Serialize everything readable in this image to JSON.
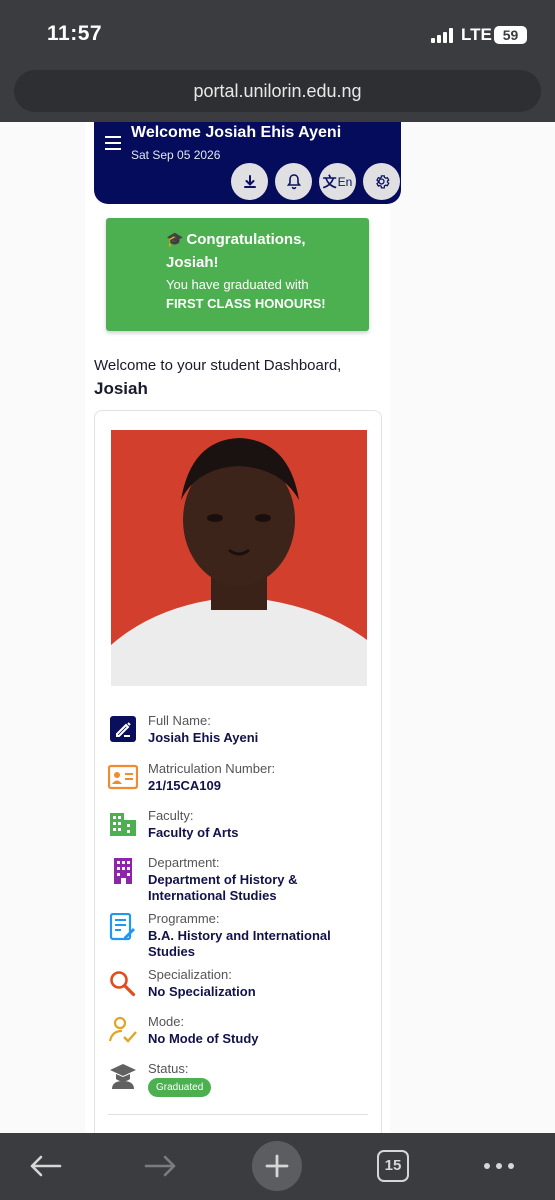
{
  "status_bar": {
    "time": "11:57",
    "network": "LTE",
    "battery": "59"
  },
  "browser": {
    "url": "portal.unilorin.edu.ng",
    "tab_count": "15"
  },
  "header": {
    "title": "Welcome Josiah Ehis Ayeni",
    "date": "Sat Sep 05 2026",
    "language_label": "En"
  },
  "congrats": {
    "line1": "Congratulations,",
    "line2": "Josiah!",
    "line3": "You have graduated with",
    "line4": "FIRST CLASS HONOURS!"
  },
  "dashboard": {
    "welcome_text": "Welcome to your student Dashboard,",
    "first_name": "Josiah"
  },
  "profile": {
    "fields": [
      {
        "label": "Full Name:",
        "value": "Josiah Ehis Ayeni",
        "icon": "edit-icon",
        "color": "#0a0f5c"
      },
      {
        "label": "Matriculation Number:",
        "value": "21/15CA109",
        "icon": "id-card-icon",
        "color": "#ef8c2e"
      },
      {
        "label": "Faculty:",
        "value": "Faculty of Arts",
        "icon": "building-icon",
        "color": "#4caf50"
      },
      {
        "label": "Department:",
        "value": "Department of History & International Studies",
        "icon": "office-building-icon",
        "color": "#8e24aa"
      },
      {
        "label": "Programme:",
        "value": "B.A. History and International Studies",
        "icon": "document-edit-icon",
        "color": "#2196f3"
      },
      {
        "label": "Specialization:",
        "value": "No Specialization",
        "icon": "magnifier-icon",
        "color": "#e64a19"
      },
      {
        "label": "Mode:",
        "value": "No Mode of Study",
        "icon": "user-check-icon",
        "color": "#e0a526"
      },
      {
        "label": "Status:",
        "value": "Graduated",
        "icon": "graduate-icon",
        "color": "#616161"
      }
    ]
  }
}
